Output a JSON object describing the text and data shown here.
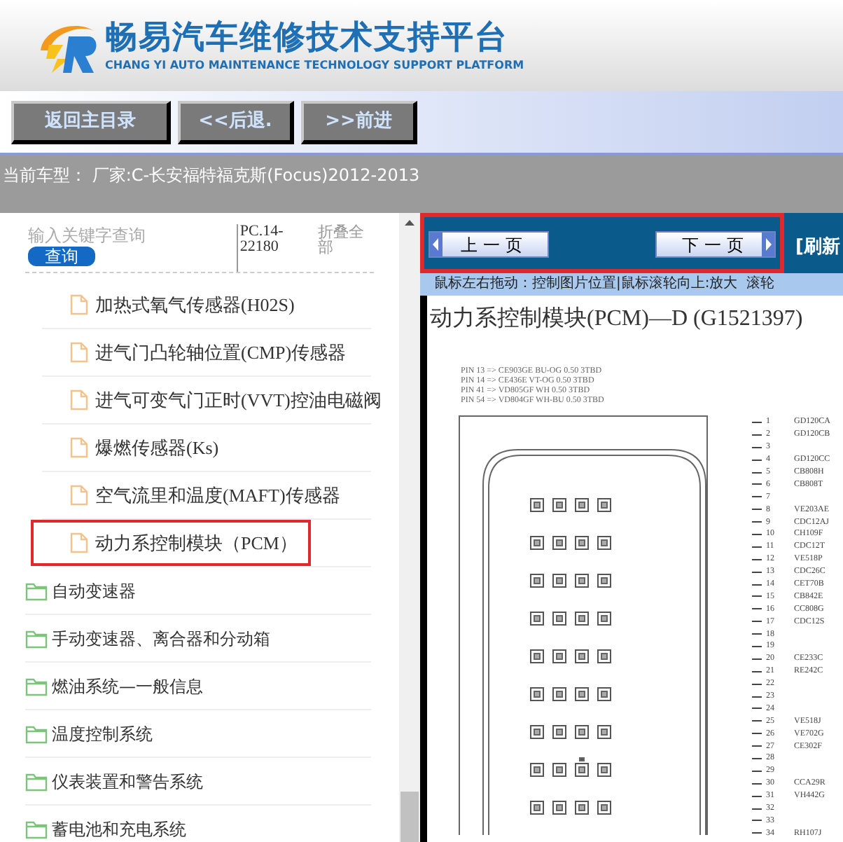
{
  "header": {
    "title": "畅易汽车维修技术支持平台",
    "subtitle": "CHANG YI AUTO MAINTENANCE TECHNOLOGY SUPPORT PLATFORM"
  },
  "nav_buttons": [
    "返回主目录",
    "<<后退.",
    ">>前进"
  ],
  "current_model": "当前车型： 厂家:C-长安福特福克斯(Focus)2012-2013",
  "search": {
    "placeholder": "输入关键字查询",
    "button": "查询",
    "code": "PC.14-22180",
    "collapse": "折叠全部"
  },
  "tree": {
    "open_branch_children": [
      {
        "label": "加热式氧气传感器(H02S)",
        "selected": false
      },
      {
        "label": "进气门凸轮轴位置(CMP)传感器",
        "selected": false
      },
      {
        "label": "进气可变气门正时(VVT)控油电磁阀",
        "selected": false
      },
      {
        "label": "爆燃传感器(Ks)",
        "selected": false
      },
      {
        "label": "空气流里和温度(MAFT)传感器",
        "selected": false
      },
      {
        "label": "动力系控制模块（PCM）",
        "selected": true
      }
    ],
    "folders": [
      {
        "label": "自动变速器",
        "selected": false
      },
      {
        "label": "手动变速器、离合器和分动箱",
        "selected": false
      },
      {
        "label": "燃油系统—一般信息",
        "selected": false
      },
      {
        "label": "温度控制系统",
        "selected": false
      },
      {
        "label": "仪表装置和警告系统",
        "selected": false
      },
      {
        "label": "蓄电池和充电系统",
        "selected": false
      }
    ]
  },
  "pager": {
    "prev": "上一页",
    "next": "下一页",
    "refresh": "[刷新"
  },
  "hint": "鼠标左右拖动：控制图片位置|鼠标滚轮向上:放大  滚轮",
  "document": {
    "title": "动力系控制模块(PCM)—D (G1521397)",
    "legend": [
      "PIN 13 => CE903GE BU-OG 0.50 3TBD",
      "PIN 14 => CE436E VT-OG 0.50 3TBD",
      "PIN 41 => VD805GF WH 0.50 3TBD",
      "PIN 54 => VD804GF WH-BU 0.50 3TBD"
    ],
    "pins": [
      {
        "number": "1",
        "code": "GD120CA"
      },
      {
        "number": "2",
        "code": "GD120CB"
      },
      {
        "number": "3"
      },
      {
        "number": "4",
        "code": "GD120CC"
      },
      {
        "number": "5",
        "code": "CB808H"
      },
      {
        "number": "6",
        "code": "CB808T"
      },
      {
        "number": "7"
      },
      {
        "number": "8",
        "code": "VE203AE"
      },
      {
        "number": "9",
        "code": "CDC12AJ"
      },
      {
        "number": "10",
        "code": "CH109F"
      },
      {
        "number": "11",
        "code": "CDC12T"
      },
      {
        "number": "12",
        "code": "VE518P"
      },
      {
        "number": "13",
        "code": "CDC26C"
      },
      {
        "number": "14",
        "code": "CET70B"
      },
      {
        "number": "15",
        "code": "CB842E"
      },
      {
        "number": "16",
        "code": "CC808G"
      },
      {
        "number": "17",
        "code": "CDC12S"
      },
      {
        "number": "18"
      },
      {
        "number": "19"
      },
      {
        "number": "20",
        "code": "CE233C"
      },
      {
        "number": "21",
        "code": "RE242C"
      },
      {
        "number": "22"
      },
      {
        "number": "23"
      },
      {
        "number": "24"
      },
      {
        "number": "25",
        "code": "VE518J"
      },
      {
        "number": "26",
        "code": "VE702G"
      },
      {
        "number": "27",
        "code": "CE302F"
      },
      {
        "number": "28"
      },
      {
        "number": "29"
      },
      {
        "number": "30",
        "code": "CCA29R"
      },
      {
        "number": "31",
        "code": "VH442G"
      },
      {
        "number": "32"
      },
      {
        "number": "33"
      },
      {
        "number": "34",
        "code": "RH107J"
      }
    ]
  }
}
